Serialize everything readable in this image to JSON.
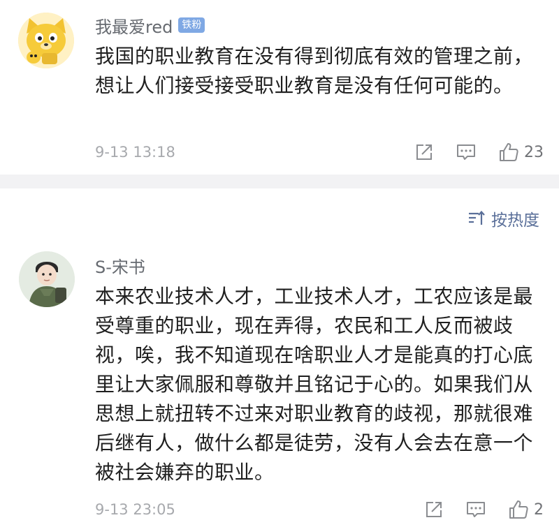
{
  "comments": [
    {
      "author": "我最爱red",
      "badge": "铁粉",
      "text": "我国的职业教育在没有得到彻底有效的管理之前，想让人们接受接受职业教育是没有任何可能的。",
      "time": "9-13 13:18",
      "likes": "23",
      "avatar_icon": "cartoon-dog-avatar"
    },
    {
      "author": "S-宋书",
      "text": "本来农业技术人才，工业技术人才，工农应该是最受尊重的职业，现在弄得，农民和工人反而被歧视，唉，我不知道现在啥职业人才是能真的打心底里让大家佩服和尊敬并且铭记于心的。如果我们从思想上就扭转不过来对职业教育的歧视，那就很难后继有人，做什么都是徒劳，没有人会去在意一个被社会嫌弃的职业。",
      "time": "9-13 23:05",
      "likes": "2",
      "avatar_icon": "soldier-avatar"
    }
  ],
  "sort": {
    "label": "按热度",
    "icon": "sort-icon"
  },
  "colors": {
    "badge": "#7fa8e4",
    "sort_text": "#5a6f99",
    "meta_gray": "#a7a9ad",
    "divider": "#f2f2f4"
  }
}
